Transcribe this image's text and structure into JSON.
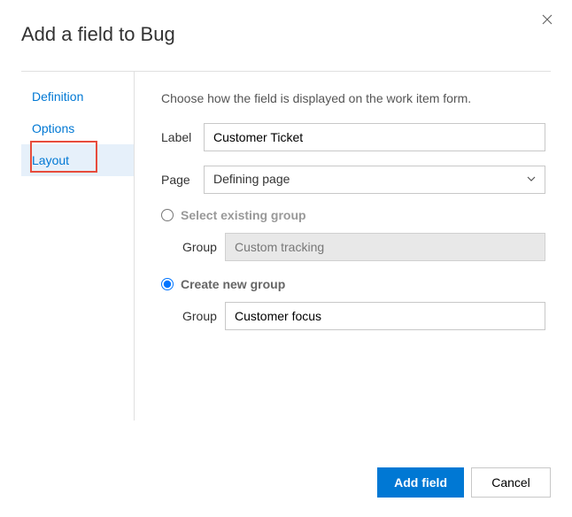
{
  "dialog": {
    "title": "Add a field to Bug"
  },
  "sidebar": {
    "tabs": {
      "definition": "Definition",
      "options": "Options",
      "layout": "Layout"
    }
  },
  "content": {
    "description": "Choose how the field is displayed on the work item form.",
    "label_field": {
      "label": "Label",
      "value": "Customer Ticket"
    },
    "page_field": {
      "label": "Page",
      "value": "Defining page"
    },
    "existing": {
      "radio_label": "Select existing group",
      "group_label": "Group",
      "group_value": "Custom tracking"
    },
    "newgroup": {
      "radio_label": "Create new group",
      "group_label": "Group",
      "group_value": "Customer focus"
    }
  },
  "footer": {
    "primary": "Add field",
    "cancel": "Cancel"
  }
}
